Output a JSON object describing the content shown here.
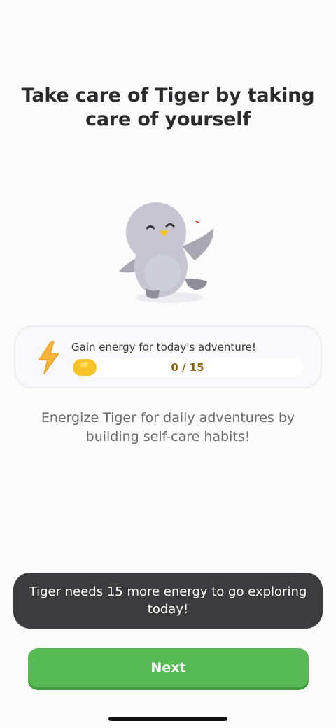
{
  "header": {
    "title_line1": "Take care of Tiger by taking",
    "title_line2": "care of yourself"
  },
  "mascot": {
    "icon": "penguin-mascot-icon"
  },
  "energy_card": {
    "icon": "lightning-bolt-icon",
    "label": "Gain energy for today's adventure!",
    "progress_text": "0 / 15",
    "progress_value": 0,
    "progress_max": 15,
    "coin_icon": "energy-coin-icon",
    "accent_color": "#f8c428"
  },
  "description": {
    "line1": "Energize Tiger for daily adventures by",
    "line2": "building self-care habits!"
  },
  "toast": {
    "line1": "Tiger needs 15 more energy to go exploring",
    "line2": "today!"
  },
  "next_button": {
    "label": "Next",
    "color": "#57ba56"
  }
}
